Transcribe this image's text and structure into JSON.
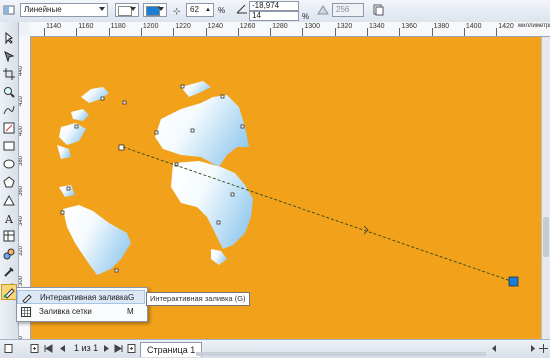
{
  "property_bar": {
    "fill_type_value": "Линейные",
    "transparency_value": "62",
    "transparency_unit": "%",
    "angle_value": "-18,974",
    "edge_pad_value": "14",
    "edge_pad_unit": "%",
    "steps_value": "256",
    "start_color": "#ffffff",
    "end_color": "#1a7fd4"
  },
  "ruler": {
    "ticks": [
      "1140",
      "1160",
      "1180",
      "1200",
      "1220",
      "1240",
      "1260",
      "1280",
      "1300",
      "1320",
      "1340",
      "1360",
      "1380",
      "1400",
      "1420"
    ],
    "unit": "миллиметры",
    "vticks": [
      "440",
      "420",
      "400",
      "380",
      "360",
      "340",
      "320",
      "300",
      "280",
      "260"
    ]
  },
  "canvas": {
    "background": "#f2a11a",
    "globe_light": "#ffffff",
    "globe_dark": "#8fc8ee"
  },
  "flyout": {
    "items": [
      {
        "label": "Интерактивная заливка",
        "key": "G"
      },
      {
        "label": "Заливка сетки",
        "key": "M"
      }
    ]
  },
  "tooltip": "Интерактивная заливка (G)",
  "bottom": {
    "page_counter": "1 из 1",
    "page_tab": "Страница 1"
  }
}
